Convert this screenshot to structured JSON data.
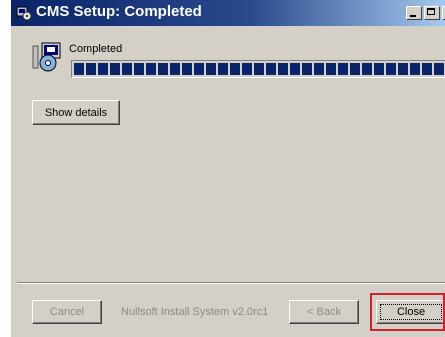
{
  "window": {
    "title": "CMS Setup: Completed",
    "title_icon": "installer-icon"
  },
  "status": {
    "label": "Completed",
    "progress": 1.0,
    "setup_icon": "install-disc-icon"
  },
  "buttons": {
    "show_details": "Show details",
    "cancel": "Cancel",
    "back": "< Back",
    "close": "Close"
  },
  "branding": "Nullsoft Install System v2.0rc1",
  "colors": {
    "titlebar": "#0a246a",
    "progress": "#0a246a",
    "highlight": "#d4212b",
    "face": "#d4d0c8"
  }
}
